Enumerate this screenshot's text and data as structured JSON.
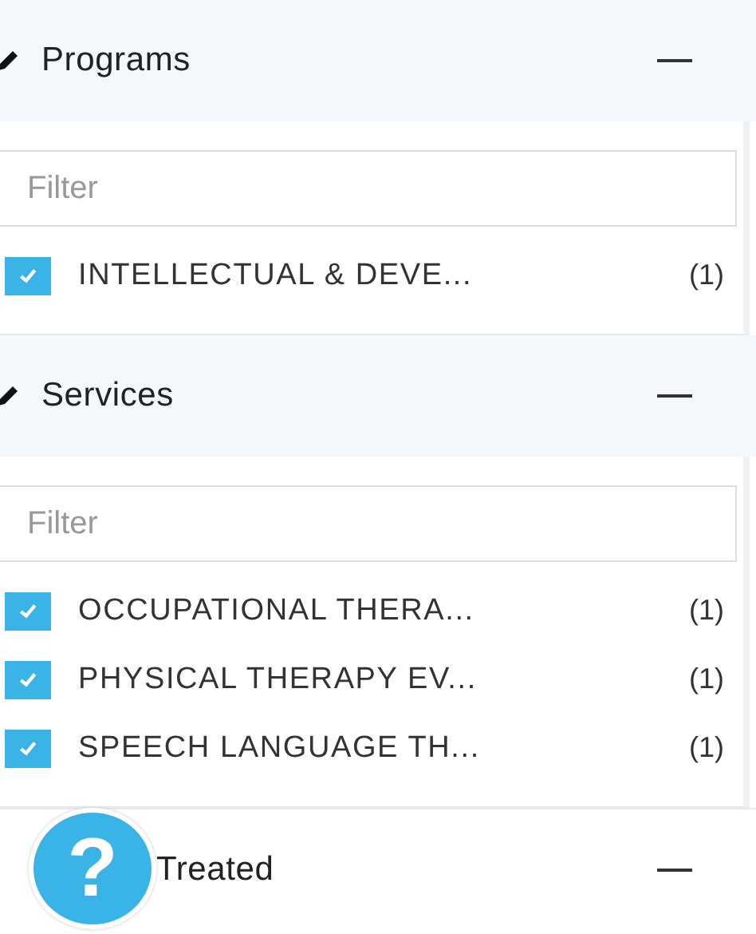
{
  "sections": [
    {
      "title": "Programs",
      "filter": {
        "placeholder": "Filter"
      },
      "items": [
        {
          "label": "INTELLECTUAL & DEVE...",
          "count": "(1)",
          "checked": true
        }
      ]
    },
    {
      "title": "Services",
      "filter": {
        "placeholder": "Filter"
      },
      "items": [
        {
          "label": "OCCUPATIONAL THERA...",
          "count": "(1)",
          "checked": true
        },
        {
          "label": "PHYSICAL THERAPY EV...",
          "count": "(1)",
          "checked": true
        },
        {
          "label": "SPEECH LANGUAGE TH...",
          "count": "(1)",
          "checked": true
        }
      ]
    },
    {
      "title": "Treated"
    }
  ],
  "help_button": {
    "label": "?"
  }
}
